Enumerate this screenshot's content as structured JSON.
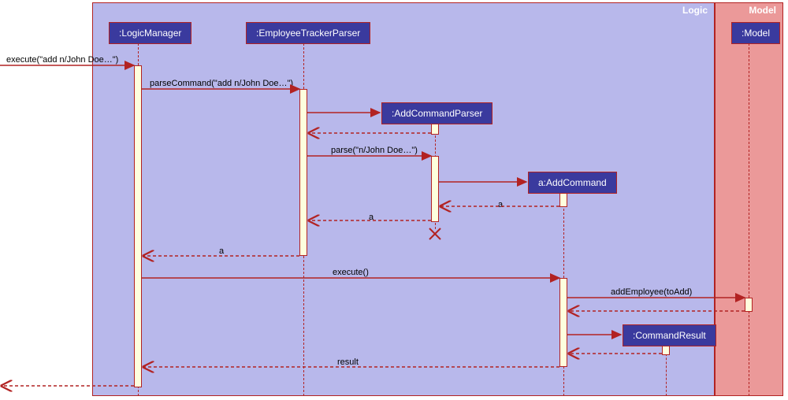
{
  "frames": {
    "logic": {
      "label": "Logic"
    },
    "model": {
      "label": "Model"
    }
  },
  "participants": {
    "logicManager": ":LogicManager",
    "employeeTrackerParser": ":EmployeeTrackerParser",
    "addCommandParser": ":AddCommandParser",
    "addCommand": "a:AddCommand",
    "commandResult": ":CommandResult",
    "model": ":Model"
  },
  "messages": {
    "m1": "execute(\"add n/John Doe…\")",
    "m2": "parseCommand(\"add n/John Doe…\")",
    "m3_return": "",
    "m4": "parse(\"n/John Doe…\")",
    "m5_return": "a",
    "m6_return": "a",
    "m7_return": "a",
    "m8": "execute()",
    "m9": "addEmployee(toAdd)",
    "m10_return": "",
    "m11_return": "",
    "m12_return": "result",
    "m13_return": ""
  },
  "chart_data": {
    "type": "sequence_diagram",
    "frames": [
      {
        "name": "Logic",
        "participants": [
          "LogicManager",
          "EmployeeTrackerParser",
          "AddCommandParser",
          "AddCommand",
          "CommandResult"
        ]
      },
      {
        "name": "Model",
        "participants": [
          "Model"
        ]
      }
    ],
    "participants": [
      {
        "id": "caller",
        "name": "(external)"
      },
      {
        "id": "LogicManager",
        "name": ":LogicManager"
      },
      {
        "id": "EmployeeTrackerParser",
        "name": ":EmployeeTrackerParser"
      },
      {
        "id": "AddCommandParser",
        "name": ":AddCommandParser",
        "created_by_msg": 3
      },
      {
        "id": "AddCommand",
        "name": "a:AddCommand",
        "created_by_msg": 5
      },
      {
        "id": "CommandResult",
        "name": ":CommandResult",
        "created_by_msg": 11
      },
      {
        "id": "Model",
        "name": ":Model"
      }
    ],
    "messages": [
      {
        "seq": 1,
        "from": "caller",
        "to": "LogicManager",
        "label": "execute(\"add n/John Doe…\")",
        "type": "sync"
      },
      {
        "seq": 2,
        "from": "LogicManager",
        "to": "EmployeeTrackerParser",
        "label": "parseCommand(\"add n/John Doe…\")",
        "type": "sync"
      },
      {
        "seq": 3,
        "from": "EmployeeTrackerParser",
        "to": "AddCommandParser",
        "label": "",
        "type": "create"
      },
      {
        "seq": 3.1,
        "from": "AddCommandParser",
        "to": "EmployeeTrackerParser",
        "label": "",
        "type": "return"
      },
      {
        "seq": 4,
        "from": "EmployeeTrackerParser",
        "to": "AddCommandParser",
        "label": "parse(\"n/John Doe…\")",
        "type": "sync"
      },
      {
        "seq": 5,
        "from": "AddCommandParser",
        "to": "AddCommand",
        "label": "",
        "type": "create"
      },
      {
        "seq": 6,
        "from": "AddCommand",
        "to": "AddCommandParser",
        "label": "a",
        "type": "return"
      },
      {
        "seq": 7,
        "from": "AddCommandParser",
        "to": "EmployeeTrackerParser",
        "label": "a",
        "type": "return"
      },
      {
        "seq": 7.1,
        "from": "AddCommandParser",
        "to": "AddCommandParser",
        "label": "",
        "type": "destroy"
      },
      {
        "seq": 8,
        "from": "EmployeeTrackerParser",
        "to": "LogicManager",
        "label": "a",
        "type": "return"
      },
      {
        "seq": 9,
        "from": "LogicManager",
        "to": "AddCommand",
        "label": "execute()",
        "type": "sync"
      },
      {
        "seq": 10,
        "from": "AddCommand",
        "to": "Model",
        "label": "addEmployee(toAdd)",
        "type": "sync"
      },
      {
        "seq": 10.1,
        "from": "Model",
        "to": "AddCommand",
        "label": "",
        "type": "return"
      },
      {
        "seq": 11,
        "from": "AddCommand",
        "to": "CommandResult",
        "label": "",
        "type": "create"
      },
      {
        "seq": 11.1,
        "from": "CommandResult",
        "to": "AddCommand",
        "label": "",
        "type": "return"
      },
      {
        "seq": 12,
        "from": "AddCommand",
        "to": "LogicManager",
        "label": "result",
        "type": "return"
      },
      {
        "seq": 13,
        "from": "LogicManager",
        "to": "caller",
        "label": "",
        "type": "return"
      }
    ]
  }
}
